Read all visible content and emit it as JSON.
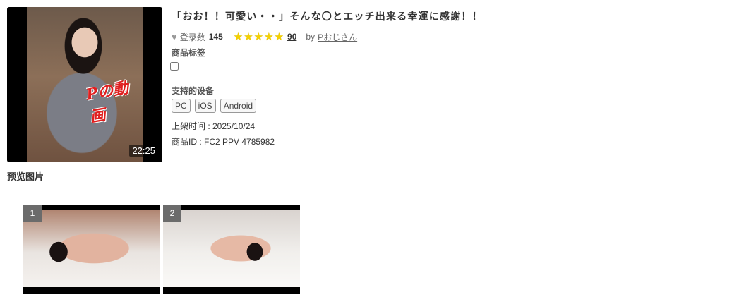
{
  "product": {
    "duration": "22:25",
    "thumb_logo": "Pの動画",
    "title": "「おお！！可愛い・・」そんな〇とエッチ出来る幸運に感謝！！",
    "favorites_label": "登录数",
    "favorites_count": "145",
    "rating_stars": 5,
    "rating_count": "90",
    "by_label": "by",
    "seller": "Pおじさん",
    "tags_label": "商品标签",
    "devices_label": "支持的设备",
    "devices": [
      "PC",
      "iOS",
      "Android"
    ],
    "release_text": "上架时间 : 2025/10/24",
    "id_text": "商品ID : FC2 PPV 4785982"
  },
  "preview": {
    "heading": "预览图片",
    "images": [
      {
        "number": "1"
      },
      {
        "number": "2"
      }
    ]
  },
  "icons": {
    "heart": "heart-icon",
    "star": "star-icon"
  },
  "colors": {
    "star": "#f5d100",
    "heart": "#999999",
    "duration_bg": "rgba(0,0,0,0.55)",
    "preview_number_bg": "#6b6b6b"
  }
}
